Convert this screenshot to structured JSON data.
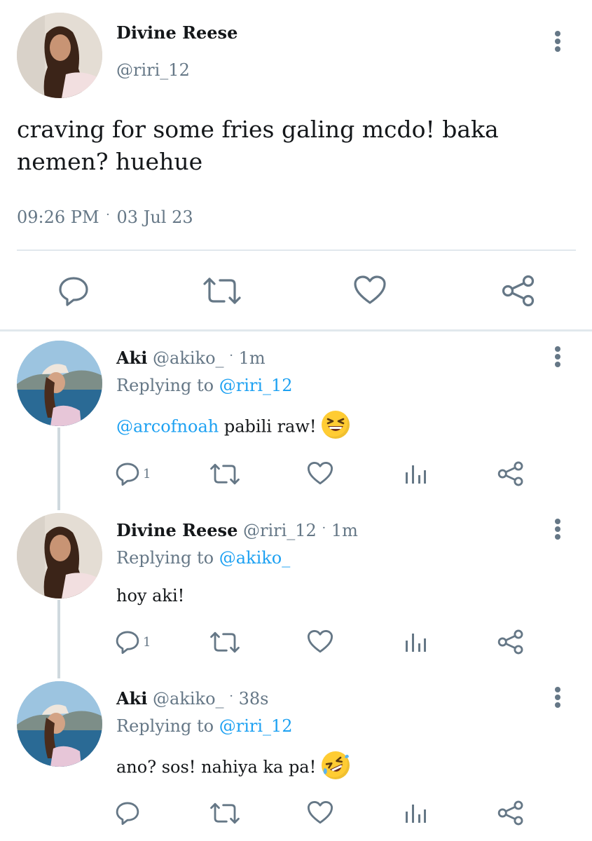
{
  "main_tweet": {
    "display_name": "Divine Reese",
    "handle": "@riri_12",
    "text_line1": "craving for some fries galing mcdo! baka",
    "text_line2": "nemen? huehue",
    "time": "09:26 PM",
    "separator": "·",
    "date": "03 Jul 23"
  },
  "replies": [
    {
      "display_name": "Aki",
      "handle": "@akiko_",
      "separator": "·",
      "age": "1m",
      "replying_prefix": "Replying to",
      "replying_to": "@riri_12",
      "mention": "@arcofnoah",
      "text": "pabili raw!",
      "emoji": "grinning-squinting-face",
      "reply_count": "1"
    },
    {
      "display_name": "Divine Reese",
      "handle": "@riri_12",
      "separator": "·",
      "age": "1m",
      "replying_prefix": "Replying to",
      "replying_to": "@akiko_",
      "text": "hoy aki!",
      "reply_count": "1"
    },
    {
      "display_name": "Aki",
      "handle": "@akiko_",
      "separator": "·",
      "age": "38s",
      "replying_prefix": "Replying to",
      "replying_to": "@riri_12",
      "text": "ano? sos! nahiya ka pa!",
      "emoji": "rolling-on-floor-laughing"
    }
  ],
  "colors": {
    "text": "#14171a",
    "muted": "#657786",
    "link": "#1da1f2",
    "divider": "#e1e8ed",
    "thread_line": "#cfd9de"
  }
}
